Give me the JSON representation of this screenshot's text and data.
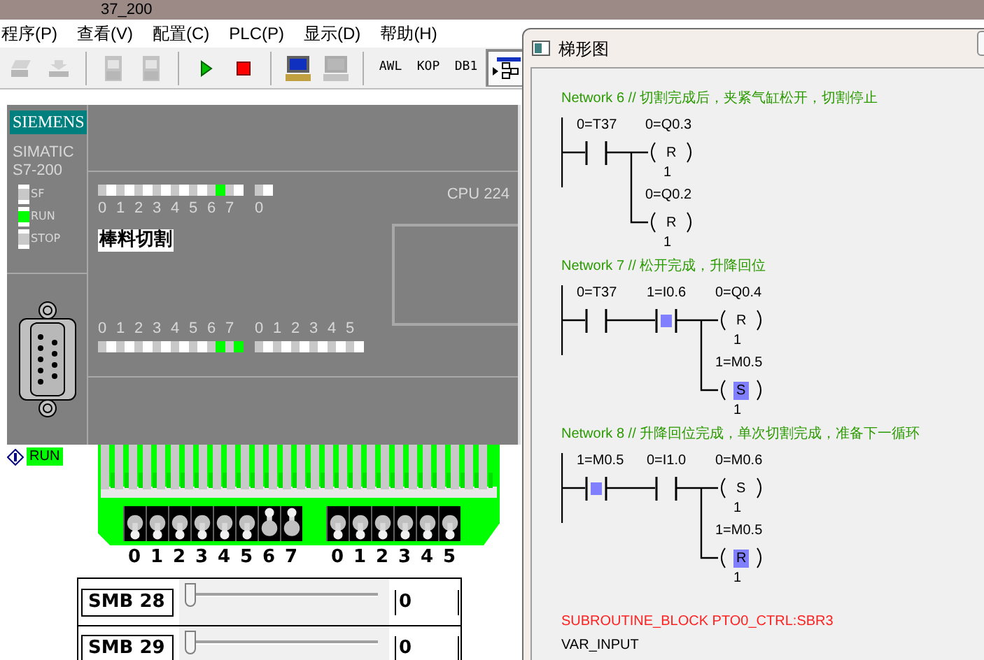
{
  "app_title": "37_200",
  "menu": [
    "程序(P)",
    "查看(V)",
    "配置(C)",
    "PLC(P)",
    "显示(D)",
    "帮助(H)"
  ],
  "toolbar": [
    [
      {
        "kind": "erase",
        "disabled": true,
        "selected": false
      },
      {
        "kind": "download",
        "disabled": true,
        "selected": false
      }
    ],
    [
      {
        "kind": "doc",
        "disabled": true,
        "selected": false
      },
      {
        "kind": "doc",
        "disabled": true,
        "selected": false
      }
    ],
    [
      {
        "kind": "run",
        "disabled": false,
        "selected": false
      },
      {
        "kind": "stop",
        "disabled": false,
        "selected": false
      }
    ],
    [
      {
        "kind": "computer",
        "disabled": false,
        "selected": false
      },
      {
        "kind": "computer",
        "disabled": true,
        "selected": false
      }
    ],
    [
      {
        "kind": "text",
        "label": "AWL",
        "disabled": false,
        "selected": false
      },
      {
        "kind": "text",
        "label": "KOP",
        "disabled": false,
        "selected": false
      },
      {
        "kind": "text",
        "label": "DB1",
        "disabled": false,
        "selected": false
      },
      {
        "kind": "ladder",
        "disabled": false,
        "selected": true
      }
    ]
  ],
  "plc": {
    "brand": "SIEMENS",
    "family": "SIMATIC",
    "series": "S7-200",
    "model": "CPU 224",
    "program_name": "棒料切割",
    "status": [
      {
        "label": "SF",
        "on": false
      },
      {
        "label": "RUN",
        "on": true
      },
      {
        "label": "STOP",
        "on": false
      }
    ],
    "inputs": [
      [
        {
          "label": "0",
          "on": false
        },
        {
          "label": "1",
          "on": false
        },
        {
          "label": "2",
          "on": false
        },
        {
          "label": "3",
          "on": false
        },
        {
          "label": "4",
          "on": false
        },
        {
          "label": "5",
          "on": false
        },
        {
          "label": "6",
          "on": true
        },
        {
          "label": "7",
          "on": false
        }
      ],
      [
        {
          "label": "0",
          "on": false
        }
      ]
    ],
    "outputs": [
      [
        {
          "label": "0",
          "on": false
        },
        {
          "label": "1",
          "on": false
        },
        {
          "label": "2",
          "on": false
        },
        {
          "label": "3",
          "on": false
        },
        {
          "label": "4",
          "on": false
        },
        {
          "label": "5",
          "on": false
        },
        {
          "label": "6",
          "on": true
        },
        {
          "label": "7",
          "on": true
        }
      ],
      [
        {
          "label": "0",
          "on": false
        },
        {
          "label": "1",
          "on": false
        },
        {
          "label": "2",
          "on": false
        },
        {
          "label": "3",
          "on": false
        },
        {
          "label": "4",
          "on": false
        },
        {
          "label": "5",
          "on": false
        }
      ]
    ]
  },
  "mode": "RUN",
  "input_switches": [
    [
      {
        "label": "0",
        "on": false
      },
      {
        "label": "1",
        "on": false
      },
      {
        "label": "2",
        "on": false
      },
      {
        "label": "3",
        "on": false
      },
      {
        "label": "4",
        "on": false
      },
      {
        "label": "5",
        "on": false
      },
      {
        "label": "6",
        "on": true
      },
      {
        "label": "7",
        "on": true
      }
    ],
    [
      {
        "label": "0",
        "on": false
      },
      {
        "label": "1",
        "on": false
      },
      {
        "label": "2",
        "on": false
      },
      {
        "label": "3",
        "on": false
      },
      {
        "label": "4",
        "on": false
      },
      {
        "label": "5",
        "on": false
      }
    ]
  ],
  "analog": [
    {
      "label": "SMB 28",
      "level": 0,
      "value": "0"
    },
    {
      "label": "SMB 29",
      "level": 0,
      "value": "0"
    }
  ],
  "ladder_window": {
    "title": "梯形图",
    "networks": [
      {
        "title": "Network 6 // 切割完成后，夹紧气缸松开，切割停止",
        "contacts": [
          {
            "label": "0=T37",
            "energized": false
          }
        ],
        "coils": [
          {
            "label": "0=Q0.3",
            "type": "R",
            "value": "1",
            "active": false
          },
          {
            "label": "0=Q0.2",
            "type": "R",
            "value": "1",
            "active": false
          }
        ]
      },
      {
        "title": "Network 7 // 松开完成，升降回位",
        "contacts": [
          {
            "label": "0=T37",
            "energized": false
          },
          {
            "label": "1=I0.6",
            "energized": true
          }
        ],
        "coils": [
          {
            "label": "0=Q0.4",
            "type": "R",
            "value": "1",
            "active": false
          },
          {
            "label": "1=M0.5",
            "type": "S",
            "value": "1",
            "active": true
          }
        ]
      },
      {
        "title": "Network 8 // 升降回位完成，单次切割完成，准备下一循环",
        "contacts": [
          {
            "label": "1=M0.5",
            "energized": true
          },
          {
            "label": "0=I1.0",
            "energized": false
          }
        ],
        "coils": [
          {
            "label": "0=M0.6",
            "type": "S",
            "value": "1",
            "active": false
          },
          {
            "label": "1=M0.5",
            "type": "R",
            "value": "1",
            "active": true
          }
        ]
      }
    ],
    "footer": [
      {
        "kind": "block",
        "text": "SUBROUTINE_BLOCK PTO0_CTRL:SBR3"
      },
      {
        "kind": "plain",
        "text": "VAR_INPUT"
      }
    ]
  }
}
